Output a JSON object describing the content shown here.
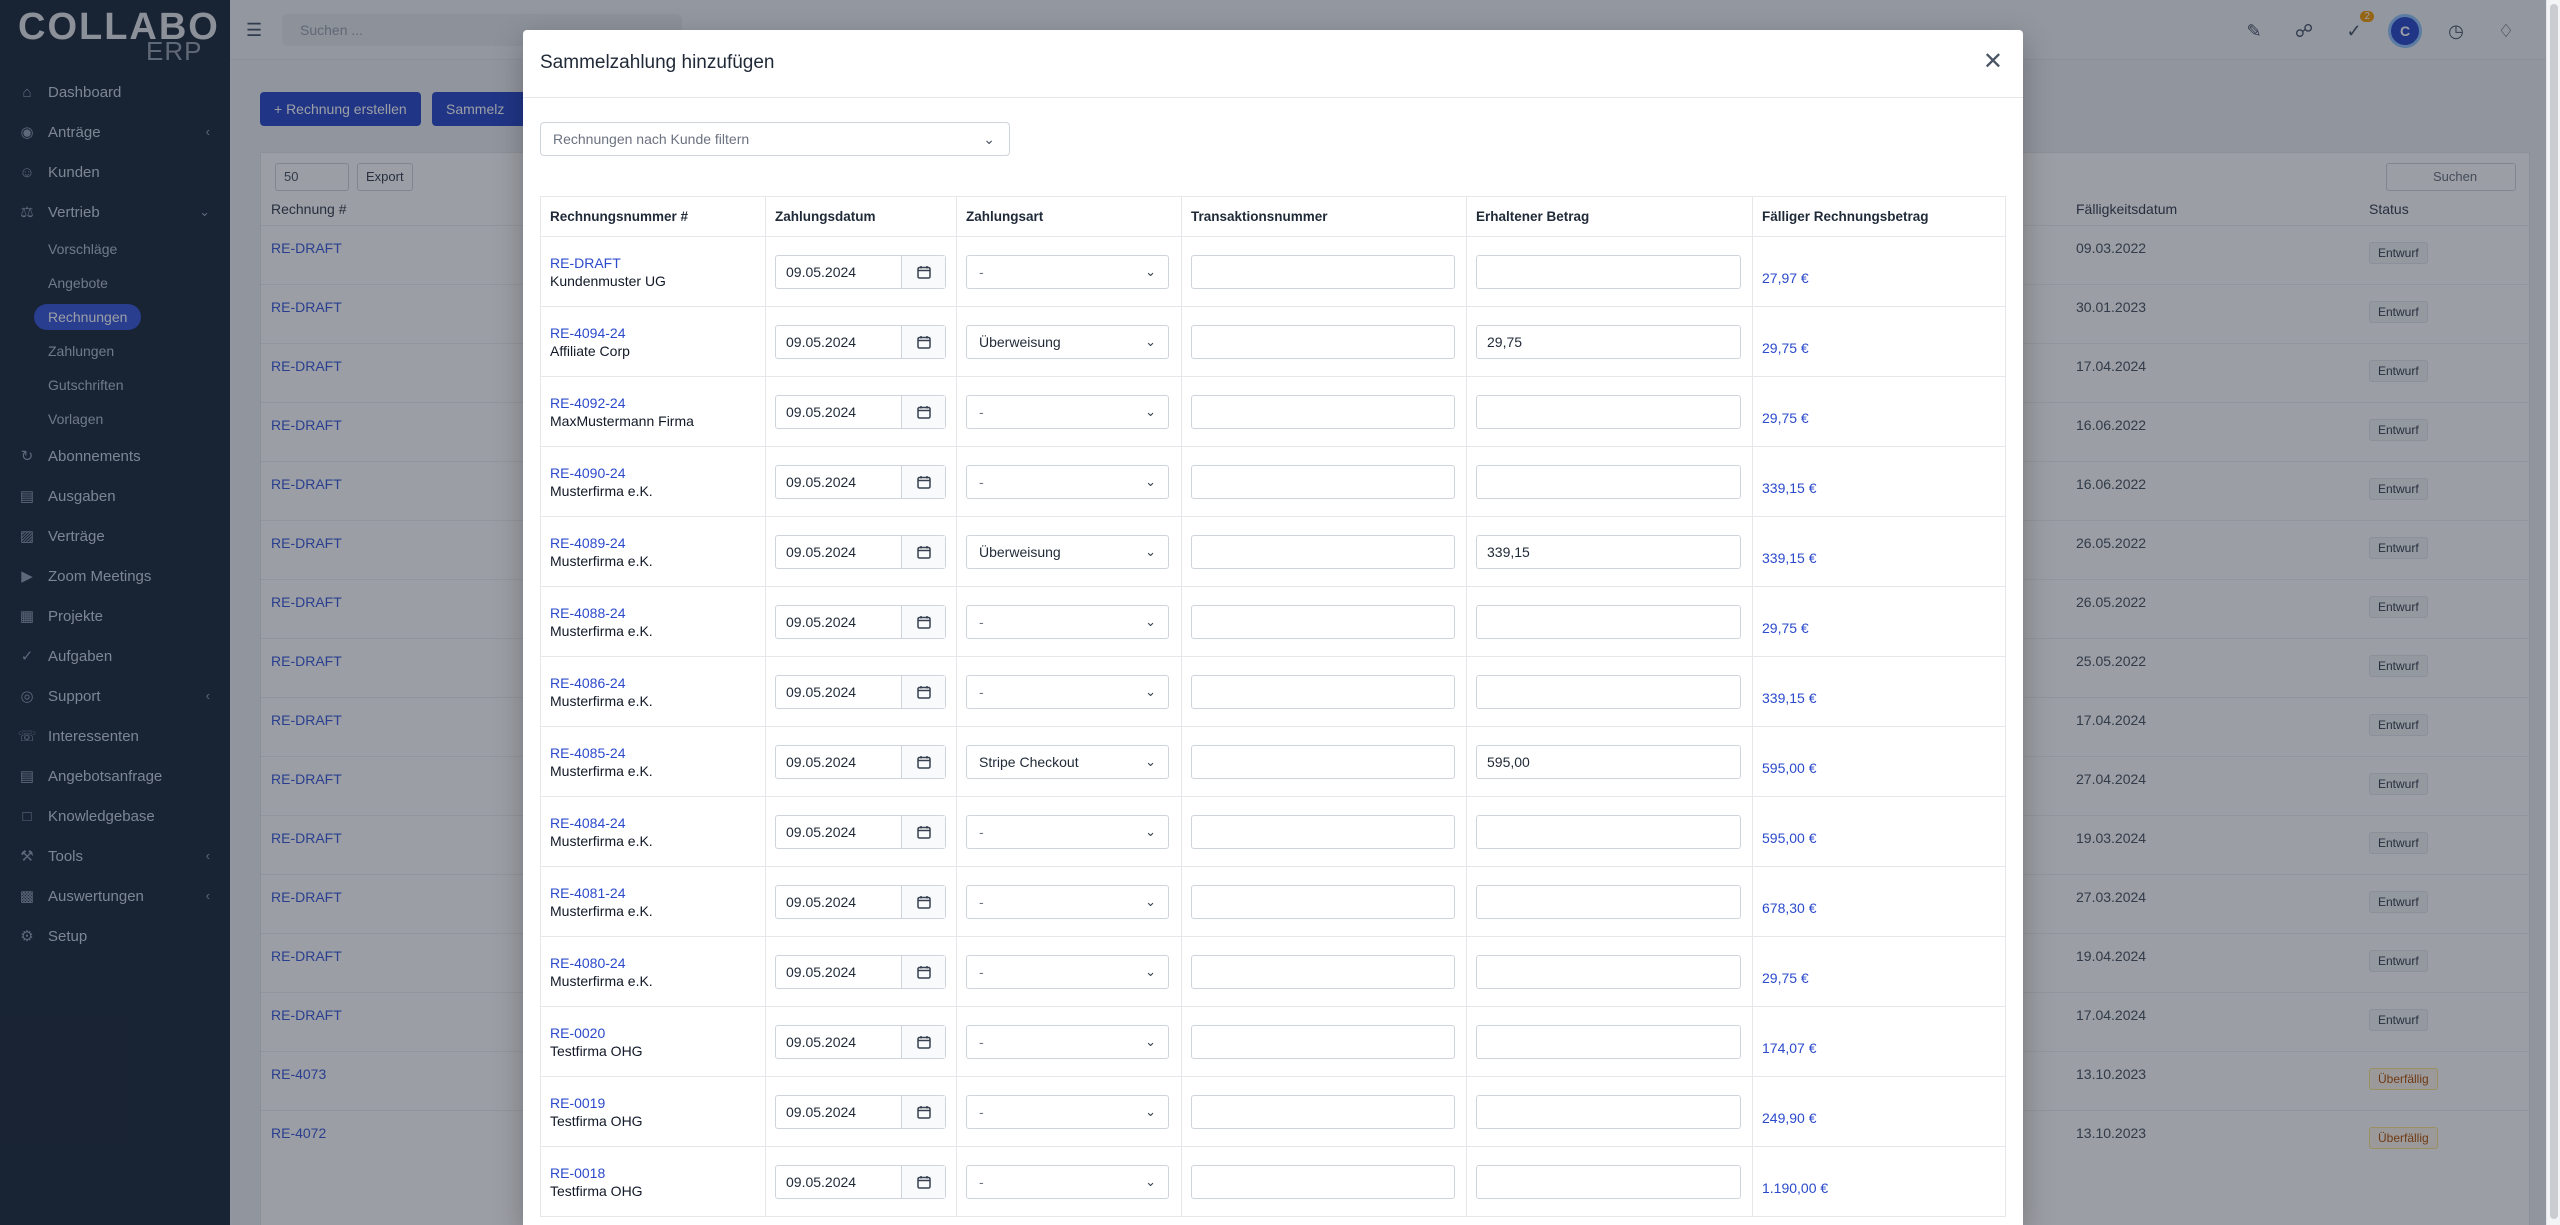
{
  "app": {
    "logo_main": "COLLABO",
    "logo_sub": "ERP"
  },
  "sidebar": {
    "items": [
      {
        "label": "Dashboard",
        "icon": "home-icon",
        "chevron": false
      },
      {
        "label": "Anträge",
        "icon": "coins-icon",
        "chevron": true
      },
      {
        "label": "Kunden",
        "icon": "user-icon",
        "chevron": false
      },
      {
        "label": "Vertrieb",
        "icon": "balance-icon",
        "chevron": true,
        "expanded": true
      }
    ],
    "subitems": [
      {
        "label": "Vorschläge"
      },
      {
        "label": "Angebote"
      },
      {
        "label": "Rechnungen",
        "active": true
      },
      {
        "label": "Zahlungen"
      },
      {
        "label": "Gutschriften"
      },
      {
        "label": "Vorlagen"
      }
    ],
    "items2": [
      {
        "label": "Abonnements",
        "icon": "repeat-icon",
        "chevron": false
      },
      {
        "label": "Ausgaben",
        "icon": "file-icon",
        "chevron": false
      },
      {
        "label": "Verträge",
        "icon": "contract-icon",
        "chevron": false
      },
      {
        "label": "Zoom Meetings",
        "icon": "video-icon",
        "chevron": false
      },
      {
        "label": "Projekte",
        "icon": "chart-icon",
        "chevron": false
      },
      {
        "label": "Aufgaben",
        "icon": "check-circle-icon",
        "chevron": false
      },
      {
        "label": "Support",
        "icon": "lifebuoy-icon",
        "chevron": true
      },
      {
        "label": "Interessenten",
        "icon": "tty-icon",
        "chevron": false
      },
      {
        "label": "Angebotsanfrage",
        "icon": "file-icon",
        "chevron": false
      },
      {
        "label": "Knowledgebase",
        "icon": "folder-icon",
        "chevron": false
      },
      {
        "label": "Tools",
        "icon": "wrench-icon",
        "chevron": true
      },
      {
        "label": "Auswertungen",
        "icon": "bar-chart-icon",
        "chevron": true
      },
      {
        "label": "Setup",
        "icon": "gear-icon",
        "chevron": false
      }
    ]
  },
  "topbar": {
    "search_placeholder": "Suchen ...",
    "avatar_letter": "C",
    "task_badge": "2"
  },
  "background": {
    "create_btn": "+ Rechnung erstellen",
    "bulk_btn": "Sammelz",
    "per_page": "50",
    "export": "Export",
    "search_placeholder": "Suchen",
    "col_invoice": "Rechnung #",
    "col_due": "Fälligkeitsdatum",
    "col_status": "Status",
    "rows": [
      {
        "inv": "RE-DRAFT",
        "date": "09.03.2022",
        "status": "Entwurf"
      },
      {
        "inv": "RE-DRAFT",
        "date": "30.01.2023",
        "status": "Entwurf"
      },
      {
        "inv": "RE-DRAFT",
        "date": "17.04.2024",
        "status": "Entwurf"
      },
      {
        "inv": "RE-DRAFT",
        "date": "16.06.2022",
        "status": "Entwurf"
      },
      {
        "inv": "RE-DRAFT",
        "date": "16.06.2022",
        "status": "Entwurf"
      },
      {
        "inv": "RE-DRAFT",
        "date": "26.05.2022",
        "status": "Entwurf"
      },
      {
        "inv": "RE-DRAFT",
        "date": "26.05.2022",
        "status": "Entwurf"
      },
      {
        "inv": "RE-DRAFT",
        "date": "25.05.2022",
        "status": "Entwurf"
      },
      {
        "inv": "RE-DRAFT",
        "date": "17.04.2024",
        "status": "Entwurf"
      },
      {
        "inv": "RE-DRAFT",
        "date": "27.04.2024",
        "status": "Entwurf"
      },
      {
        "inv": "RE-DRAFT",
        "date": "19.03.2024",
        "status": "Entwurf"
      },
      {
        "inv": "RE-DRAFT",
        "date": "27.03.2024",
        "status": "Entwurf"
      },
      {
        "inv": "RE-DRAFT",
        "date": "19.04.2024",
        "status": "Entwurf"
      },
      {
        "inv": "RE-DRAFT",
        "date": "17.04.2024",
        "status": "Entwurf"
      },
      {
        "inv": "RE-4073",
        "date": "13.10.2023",
        "status": "Überfällig"
      },
      {
        "inv": "RE-4072",
        "date": "13.10.2023",
        "status": "Überfällig"
      }
    ]
  },
  "modal": {
    "title": "Sammelzahlung hinzufügen",
    "customer_filter_placeholder": "Rechnungen nach Kunde filtern",
    "columns": [
      "Rechnungsnummer #",
      "Zahlungsdatum",
      "Zahlungsart",
      "Transaktionsnummer",
      "Erhaltener Betrag",
      "Fälliger Rechnungsbetrag"
    ],
    "rows": [
      {
        "invoice": "RE-DRAFT",
        "customer": "Kundenmuster UG",
        "date": "09.05.2024",
        "method": "-",
        "transaction": "",
        "amount": "",
        "due": "27,97 €"
      },
      {
        "invoice": "RE-4094-24",
        "customer": "Affiliate Corp",
        "date": "09.05.2024",
        "method": "Überweisung",
        "transaction": "",
        "amount": "29,75",
        "due": "29,75 €"
      },
      {
        "invoice": "RE-4092-24",
        "customer": "MaxMustermann Firma",
        "date": "09.05.2024",
        "method": "-",
        "transaction": "",
        "amount": "",
        "due": "29,75 €"
      },
      {
        "invoice": "RE-4090-24",
        "customer": "Musterfirma e.K.",
        "date": "09.05.2024",
        "method": "-",
        "transaction": "",
        "amount": "",
        "due": "339,15 €"
      },
      {
        "invoice": "RE-4089-24",
        "customer": "Musterfirma e.K.",
        "date": "09.05.2024",
        "method": "Überweisung",
        "transaction": "",
        "amount": "339,15",
        "due": "339,15 €"
      },
      {
        "invoice": "RE-4088-24",
        "customer": "Musterfirma e.K.",
        "date": "09.05.2024",
        "method": "-",
        "transaction": "",
        "amount": "",
        "due": "29,75 €"
      },
      {
        "invoice": "RE-4086-24",
        "customer": "Musterfirma e.K.",
        "date": "09.05.2024",
        "method": "-",
        "transaction": "",
        "amount": "",
        "due": "339,15 €"
      },
      {
        "invoice": "RE-4085-24",
        "customer": "Musterfirma e.K.",
        "date": "09.05.2024",
        "method": "Stripe Checkout",
        "transaction": "",
        "amount": "595,00",
        "due": "595,00 €"
      },
      {
        "invoice": "RE-4084-24",
        "customer": "Musterfirma e.K.",
        "date": "09.05.2024",
        "method": "-",
        "transaction": "",
        "amount": "",
        "due": "595,00 €"
      },
      {
        "invoice": "RE-4081-24",
        "customer": "Musterfirma e.K.",
        "date": "09.05.2024",
        "method": "-",
        "transaction": "",
        "amount": "",
        "due": "678,30 €"
      },
      {
        "invoice": "RE-4080-24",
        "customer": "Musterfirma e.K.",
        "date": "09.05.2024",
        "method": "-",
        "transaction": "",
        "amount": "",
        "due": "29,75 €"
      },
      {
        "invoice": "RE-0020",
        "customer": "Testfirma OHG",
        "date": "09.05.2024",
        "method": "-",
        "transaction": "",
        "amount": "",
        "due": "174,07 €"
      },
      {
        "invoice": "RE-0019",
        "customer": "Testfirma OHG",
        "date": "09.05.2024",
        "method": "-",
        "transaction": "",
        "amount": "",
        "due": "249,90 €"
      },
      {
        "invoice": "RE-0018",
        "customer": "Testfirma OHG",
        "date": "09.05.2024",
        "method": "-",
        "transaction": "",
        "amount": "",
        "due": "1.190,00 €"
      }
    ]
  },
  "colors": {
    "sidebar_bg": "#1e2b3e",
    "accent": "#2b4acb",
    "link": "#2b4acb"
  }
}
